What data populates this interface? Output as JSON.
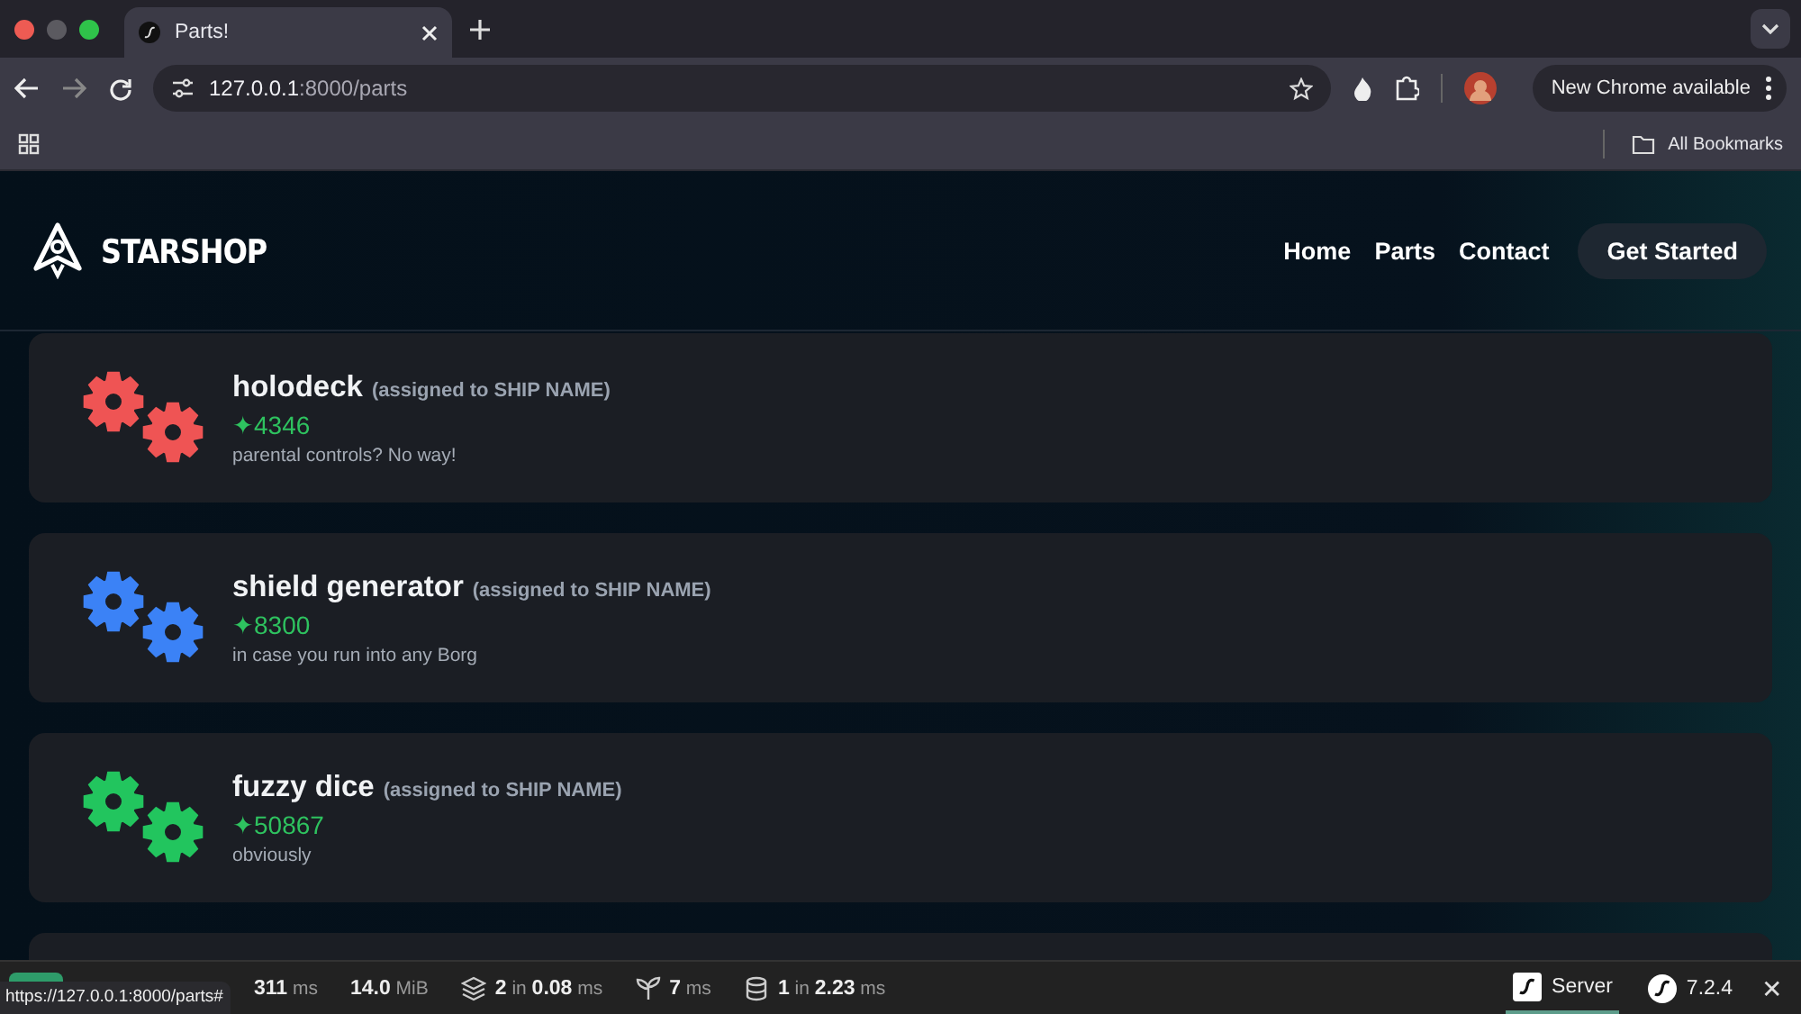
{
  "browser": {
    "tabs": [
      {
        "title": "Parts!",
        "selected": true
      }
    ],
    "address": {
      "host": "127.0.0.1",
      "rest": ":8000/parts"
    },
    "update_button": "New Chrome available",
    "bookmarks": [
      "All Bookmarks"
    ]
  },
  "site": {
    "logo": "STARSHOP",
    "nav": [
      {
        "label": "Home"
      },
      {
        "label": "Parts"
      },
      {
        "label": "Contact"
      }
    ],
    "cta": "Get Started"
  },
  "parts": [
    {
      "name": "holodeck",
      "assigned": "(assigned to SHIP NAME)",
      "price": "✦4346",
      "description": "parental controls? No way!",
      "color": "#ef5454"
    },
    {
      "name": "shield generator",
      "assigned": "(assigned to SHIP NAME)",
      "price": "✦8300",
      "description": "in case you run into any Borg",
      "color": "#3b82f6"
    },
    {
      "name": "fuzzy dice",
      "assigned": "(assigned to SHIP NAME)",
      "price": "✦50867",
      "description": "obviously",
      "color": "#22c55e"
    }
  ],
  "debug_bar": {
    "items": [
      {
        "kind": "time",
        "value": "311",
        "unit": "ms"
      },
      {
        "kind": "memory",
        "value": "14.0",
        "unit": "MiB"
      },
      {
        "kind": "cache",
        "count": "2",
        "sep": "in",
        "value": "0.08",
        "unit": "ms"
      },
      {
        "kind": "twig",
        "value": "7",
        "unit": "ms"
      },
      {
        "kind": "db",
        "count": "1",
        "sep": "in",
        "value": "2.23",
        "unit": "ms"
      }
    ],
    "server": "Server",
    "version": "7.2.4",
    "close": "✕"
  },
  "status_url": "https://127.0.0.1:8000/parts#"
}
